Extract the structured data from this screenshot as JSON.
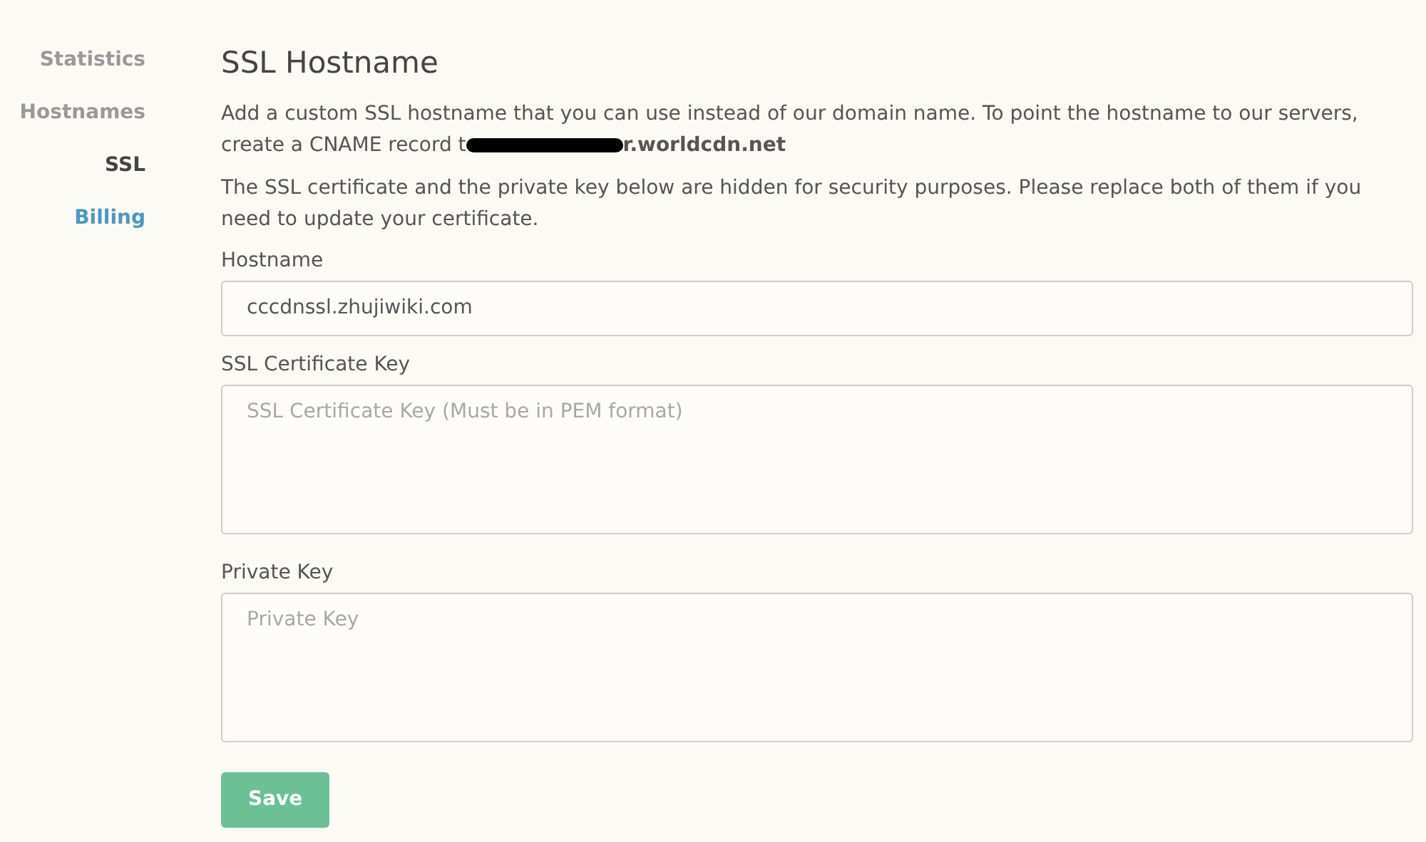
{
  "sidebar": {
    "items": [
      {
        "label": "Statistics",
        "kind": "plain",
        "selected": false
      },
      {
        "label": "Hostnames",
        "kind": "plain",
        "selected": false
      },
      {
        "label": "SSL",
        "kind": "plain",
        "selected": true
      },
      {
        "label": "Billing",
        "kind": "link",
        "selected": false
      }
    ]
  },
  "title": "SSL Hostname",
  "intro": {
    "before": "Add a custom SSL hostname that you can use instead of our domain name. To point the hostname to our servers, create a CNAME record t",
    "redacted": true,
    "after": "**r.worldcdn.net**"
  },
  "notice": "The SSL certificate and the private key below are hidden for security purposes. Please replace both of them if you need to update your certificate.",
  "fields": [
    {
      "label": "Hostname",
      "kind": "input",
      "value": "cccdnssl.zhujiwiki.com"
    },
    {
      "label": "SSL Certificate Key",
      "kind": "textarea",
      "placeholder": "SSL Certificate Key (Must be in PEM format)"
    },
    {
      "label": "Private Key",
      "kind": "textarea",
      "placeholder": "Private Key"
    }
  ],
  "save_button": "Save"
}
